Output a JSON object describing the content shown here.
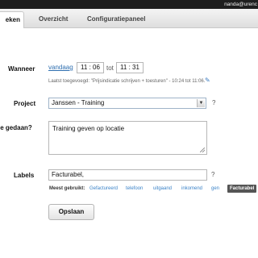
{
  "topbar": {
    "user": "nanda@urenc"
  },
  "nav": {
    "tabs": [
      {
        "label": "eken",
        "active": true
      },
      {
        "label": "Overzicht",
        "active": false
      },
      {
        "label": "Configuratiepaneel",
        "active": false
      }
    ]
  },
  "form": {
    "wanneer": {
      "label": "Wanneer",
      "date_link": "vandaag",
      "start_hour": "11",
      "start_min": "06",
      "separator": ":",
      "tot": "tot",
      "end_hour": "11",
      "end_min": "31",
      "last_added": "Laatst toegevoegd: \"Prijsindicatie schrijven + toesturen\" - 10:24 tot 11:06."
    },
    "project": {
      "label": "Project",
      "selected": "Janssen - Training",
      "help": "?"
    },
    "description": {
      "label": "je gedaan?",
      "value": "Training geven op locatie"
    },
    "labels": {
      "label": "Labels",
      "value": "Facturabel,",
      "help": "?",
      "most_used_label": "Meest gebruikt:",
      "suggestions": [
        "Gefactureerd",
        "telefoon",
        "uitgaand",
        "inkomend",
        "gen"
      ],
      "active_suggestion": "Facturabel"
    },
    "save_label": "Opslaan"
  },
  "colors": {
    "link": "#2f6fb0",
    "topbar": "#1e1e1e",
    "active_chip": "#555555"
  }
}
